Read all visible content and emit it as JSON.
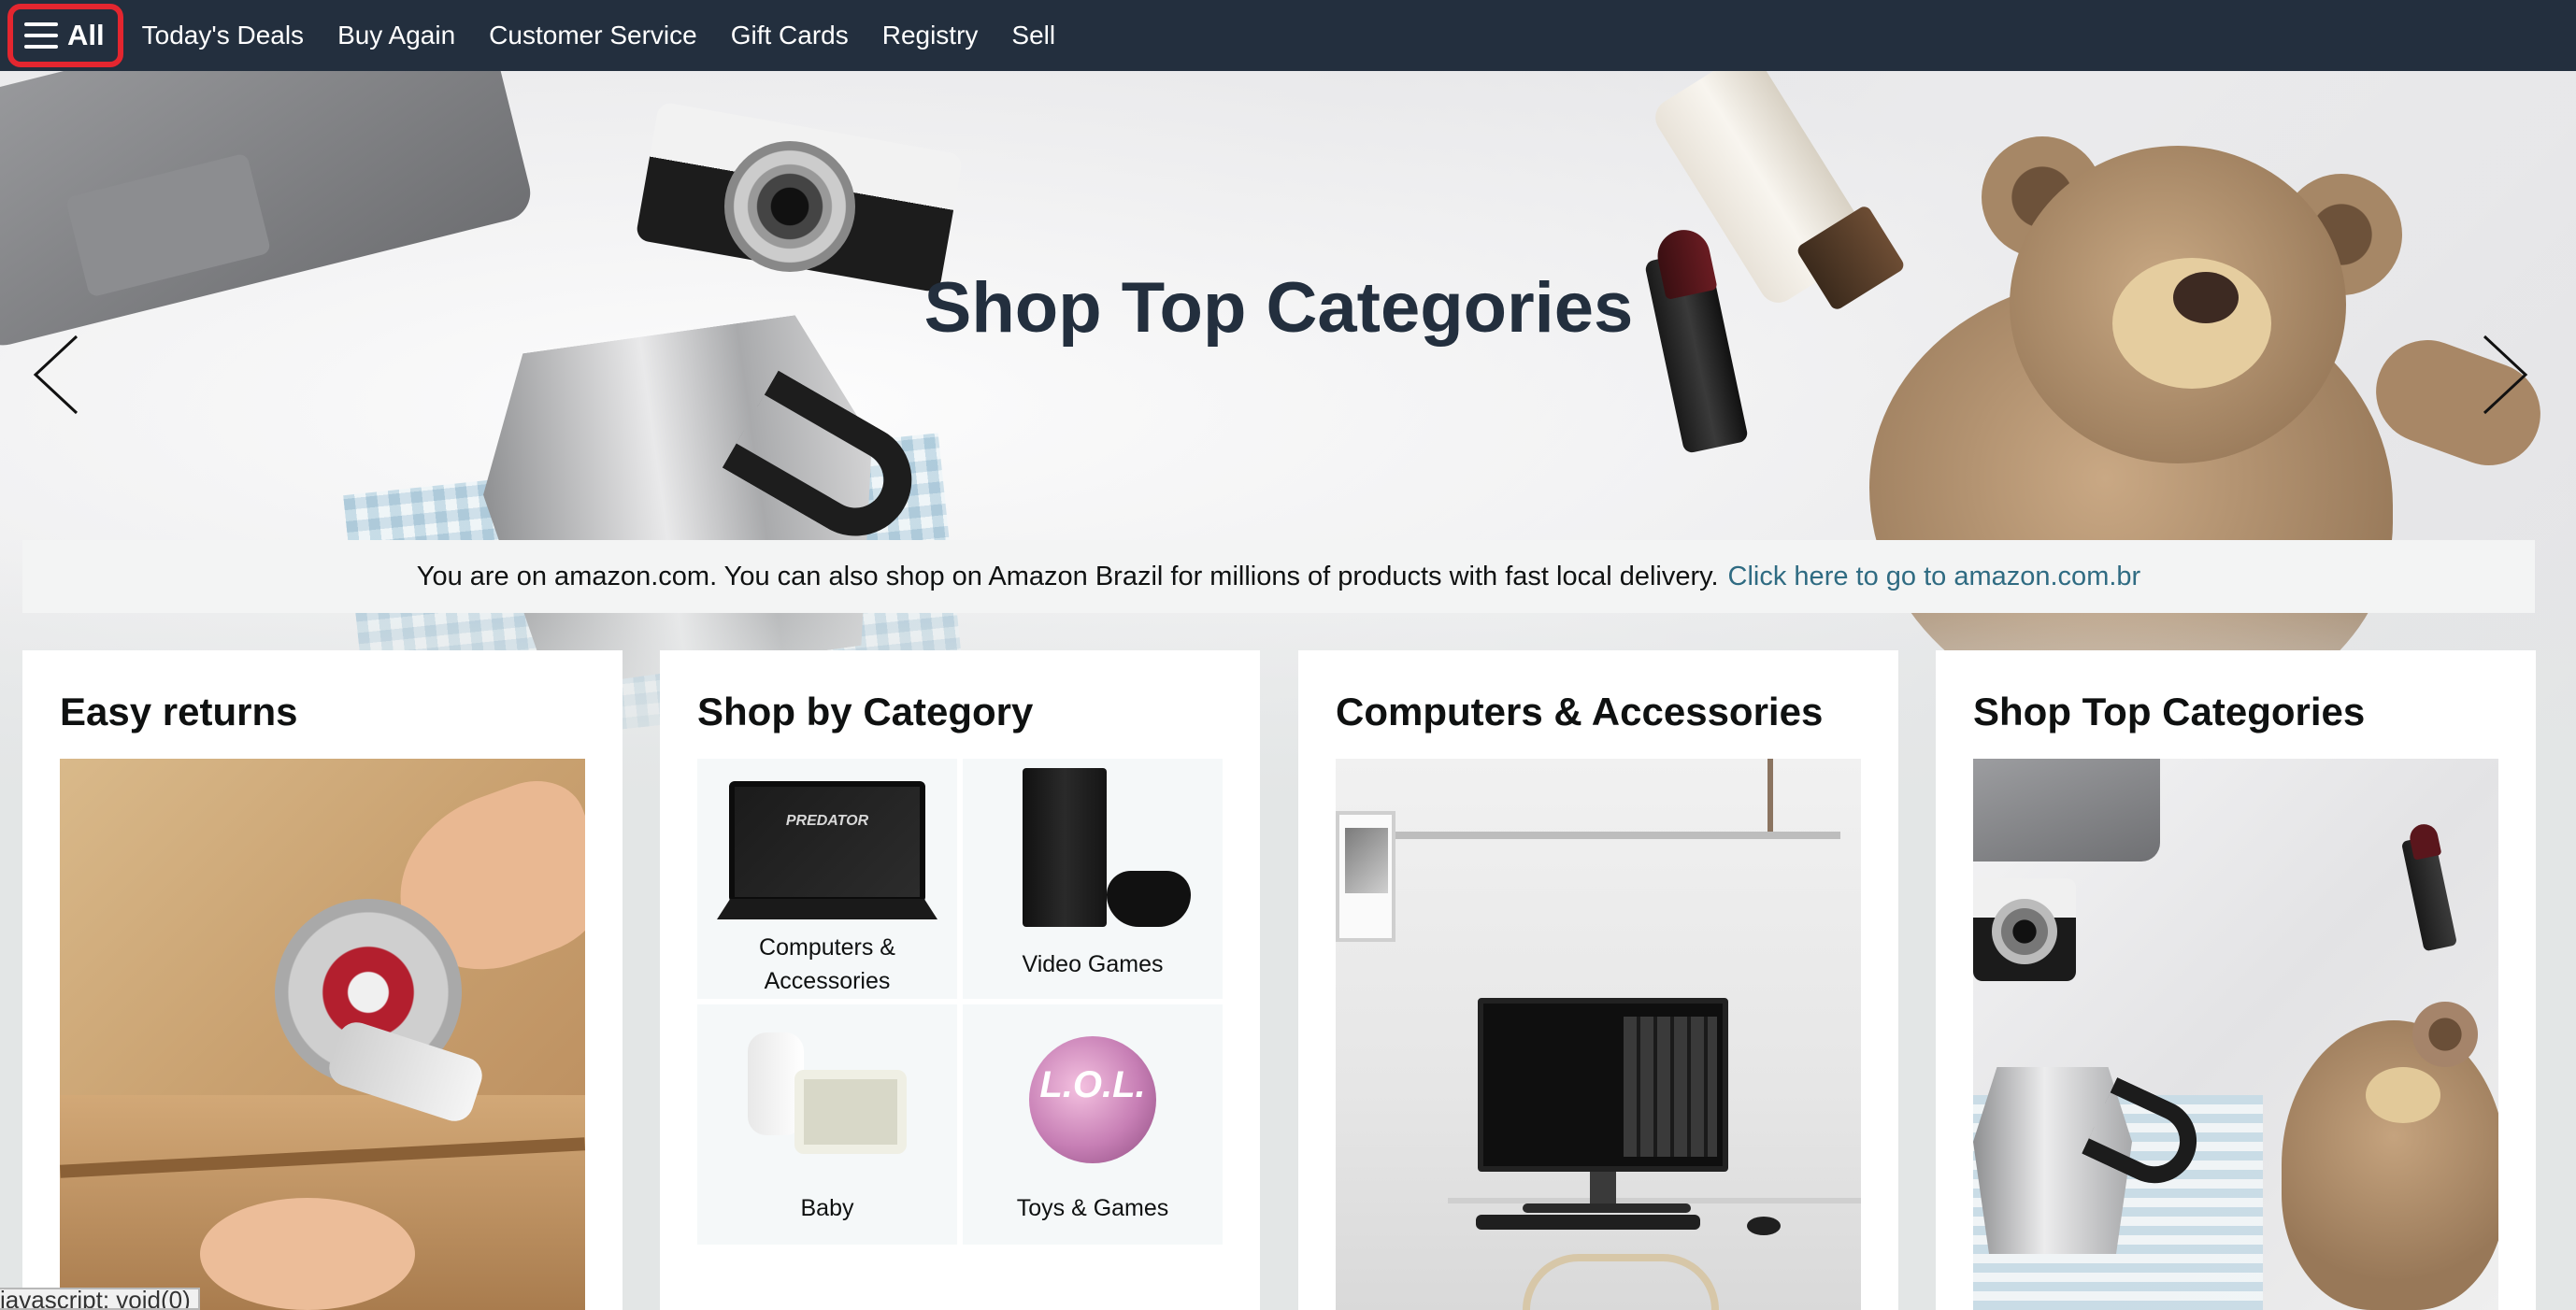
{
  "nav": {
    "all_label": "All",
    "links": [
      "Today's Deals",
      "Buy Again",
      "Customer Service",
      "Gift Cards",
      "Registry",
      "Sell"
    ]
  },
  "hero": {
    "title": "Shop Top Categories",
    "prev_icon": "chevron-left-icon",
    "next_icon": "chevron-right-icon"
  },
  "geo_banner": {
    "text": "You are on amazon.com. You can also shop on Amazon Brazil for millions of products with fast local delivery.",
    "link": "Click here to go to amazon.com.br"
  },
  "cards": [
    {
      "title": "Easy returns"
    },
    {
      "title": "Shop by Category",
      "items": [
        {
          "label": "Computers & Accessories",
          "line1": "Computers &",
          "line2": "Accessories",
          "thumb_text": "PREDATOR"
        },
        {
          "label": "Video Games"
        },
        {
          "label": "Baby"
        },
        {
          "label": "Toys & Games",
          "thumb_text": "L.O.L."
        }
      ]
    },
    {
      "title": "Computers & Accessories"
    },
    {
      "title": "Shop Top Categories"
    }
  ],
  "status_bar": {
    "text": "javascript: void(0)"
  },
  "colors": {
    "nav_bg": "#232f3e",
    "page_bg": "#e3e6e6",
    "link": "#2f6b82",
    "highlight": "#e4262f"
  }
}
